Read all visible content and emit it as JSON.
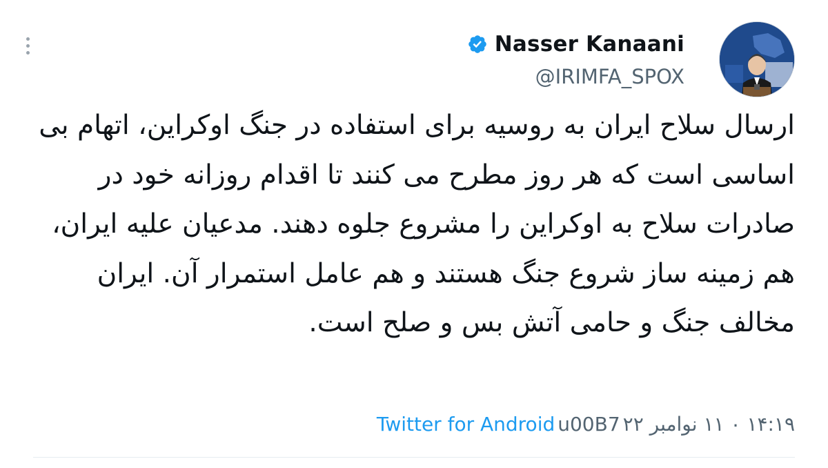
{
  "menu": {
    "icon": "more-vertical-icon"
  },
  "author": {
    "display_name": "Nasser Kanaani",
    "handle": "@IRIMFA_SPOX",
    "verified_icon": "verified-badge-icon",
    "avatar_icon": "avatar-photo"
  },
  "tweet": {
    "text": "ارسال سلاح ایران به روسیه برای استفاده در جنگ اوکراین، اتهام بی اساسی است که هر روز مطرح می کنند تا اقدام روزانه خود در صادرات سلاح به اوکراین را مشروع جلوه دهند. مدعیان علیه ایران، هم زمینه ساز شروع جنگ هستند و هم عامل استمرار آن. ایران مخالف جنگ و حامی آتش بس و صلح است."
  },
  "meta": {
    "time": "۱۴:۱۹ ۰ ۱۱ نوامبر ۲۲",
    "separator": "u00B7",
    "source": "Twitter for Android"
  },
  "colors": {
    "accent": "#1d9bf0",
    "text": "#0f1419",
    "secondary": "#536471"
  }
}
